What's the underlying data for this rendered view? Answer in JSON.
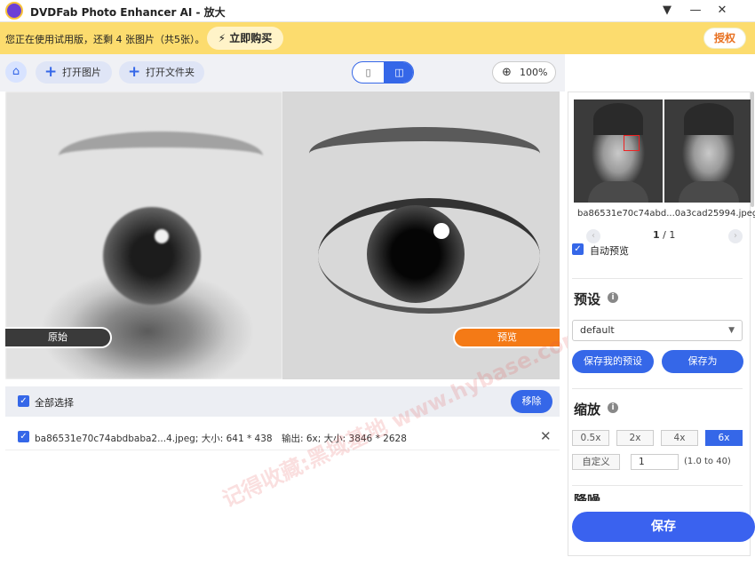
{
  "titlebar": {
    "title": "DVDFab Photo Enhancer AI - 放大",
    "menu_icon": "▼",
    "minimize_icon": "—",
    "close_icon": "✕"
  },
  "banner": {
    "trial_text": "您正在使用试用版，还剩 4 张图片（共5张）。",
    "buy_label": "立即购买",
    "authorize_label": "授权"
  },
  "toolbar": {
    "open_image_label": "打开图片",
    "open_folder_label": "打开文件夹",
    "zoom_label": "100%"
  },
  "preview": {
    "original_label": "原始",
    "preview_label": "预览"
  },
  "selection_bar": {
    "select_all_label": "全部选择",
    "remove_label": "移除"
  },
  "file_list": [
    {
      "name": "ba86531e70c74abdbaba2...4.jpeg; 大小: 641 * 438",
      "output": "输出: 6x; 大小: 3846 * 2628"
    }
  ],
  "watermark_text": "记得收藏:黑域基地 www.hybase.com",
  "side_panel": {
    "thumb_caption": "ba86531e70c74abd...0a3cad25994.jpeg",
    "pager_current": "1",
    "pager_total": "/ 1",
    "auto_preview_label": "自动预览",
    "preset_title": "预设",
    "preset_value": "default",
    "save_preset_label": "保存我的预设",
    "save_as_label": "保存为",
    "scale_title": "缩放",
    "scale_options": [
      "0.5x",
      "2x",
      "4x",
      "6x"
    ],
    "scale_selected": "6x",
    "custom_label": "自定义",
    "custom_value": "1",
    "custom_range": "(1.0 to 40)",
    "next_section_title": "降噪",
    "save_label": "保存"
  },
  "colors": {
    "accent": "#3567e8",
    "banner": "#fcdc6e",
    "preview_label_bg": "#f47a16",
    "authorize_text": "#e87020"
  }
}
